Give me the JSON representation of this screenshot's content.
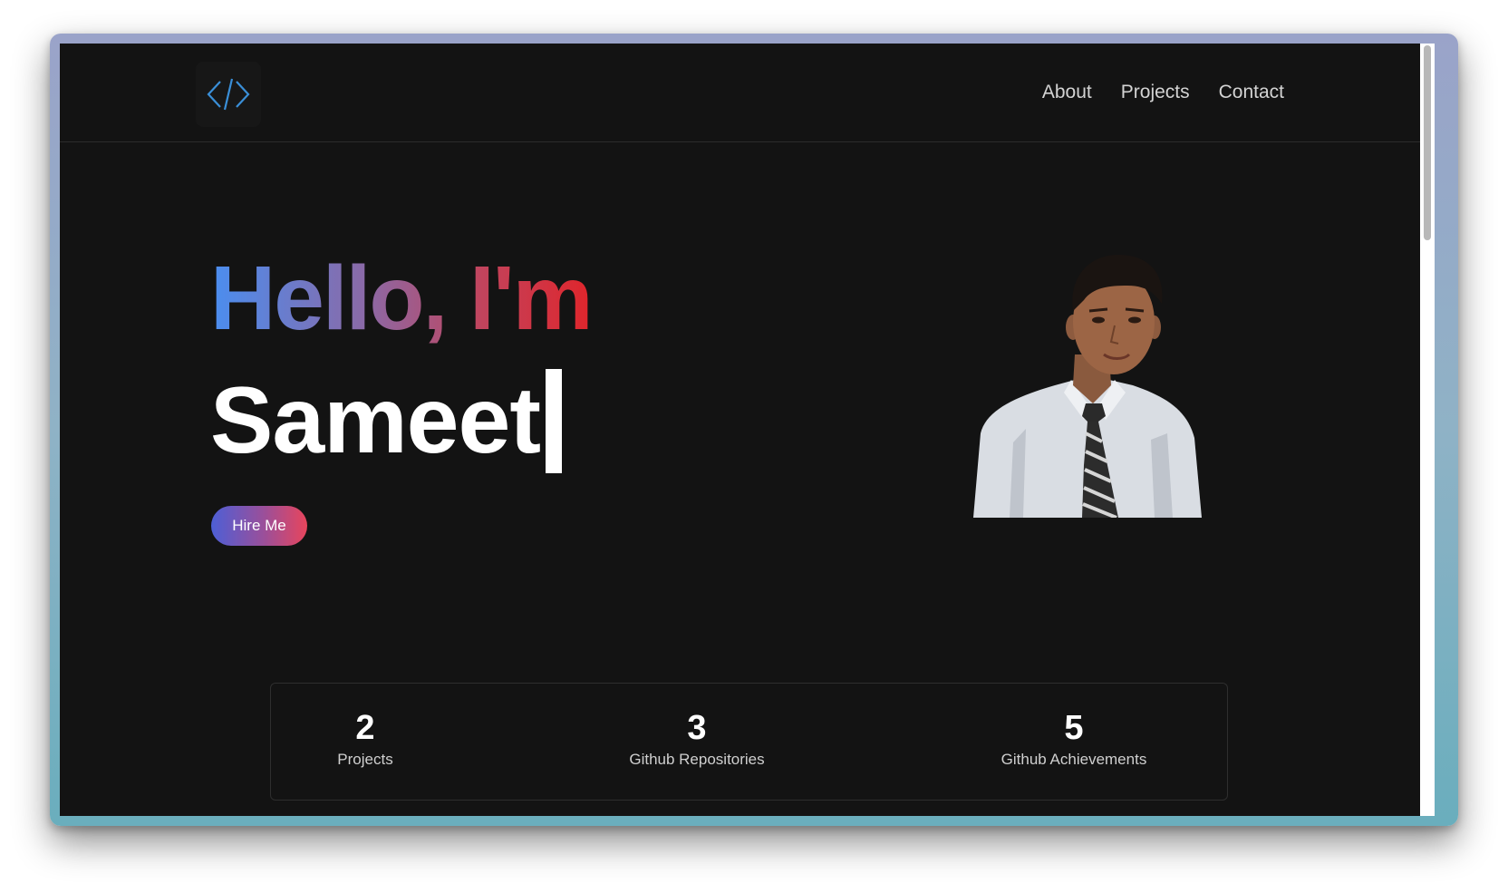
{
  "nav": {
    "logo_icon": "code-brackets-icon",
    "links": [
      "About",
      "Projects",
      "Contact"
    ]
  },
  "hero": {
    "greeting": "Hello, I'm",
    "name": "Sameet",
    "cta_label": "Hire Me",
    "portrait_alt": "portrait photo"
  },
  "stats": [
    {
      "value": "2",
      "label": "Projects"
    },
    {
      "value": "3",
      "label": "Github Repositories"
    },
    {
      "value": "5",
      "label": "Github Achievements"
    }
  ],
  "colors": {
    "background": "#131313",
    "accent_blue": "#4a8ef0",
    "accent_red": "#e0252b",
    "logo_stroke": "#3a8fd8"
  }
}
